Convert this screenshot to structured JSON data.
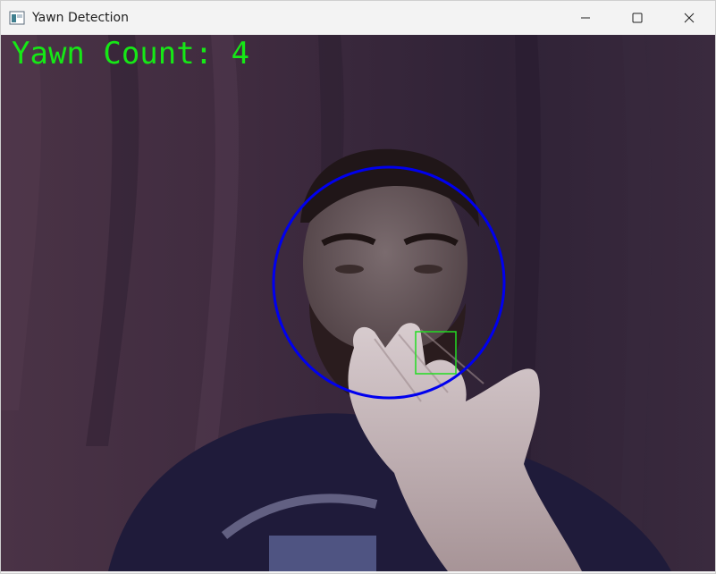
{
  "window": {
    "title": "Yawn Detection"
  },
  "icons": {
    "app": "app-window-icon",
    "minimize": "minimize-icon",
    "maximize": "maximize-icon",
    "close": "close-icon"
  },
  "overlay": {
    "yawn_count_text": "Yawn Count: 4",
    "text_color": "#16e816",
    "face_circle_color": "#0000ee",
    "mouth_box_color": "#22dd22"
  }
}
